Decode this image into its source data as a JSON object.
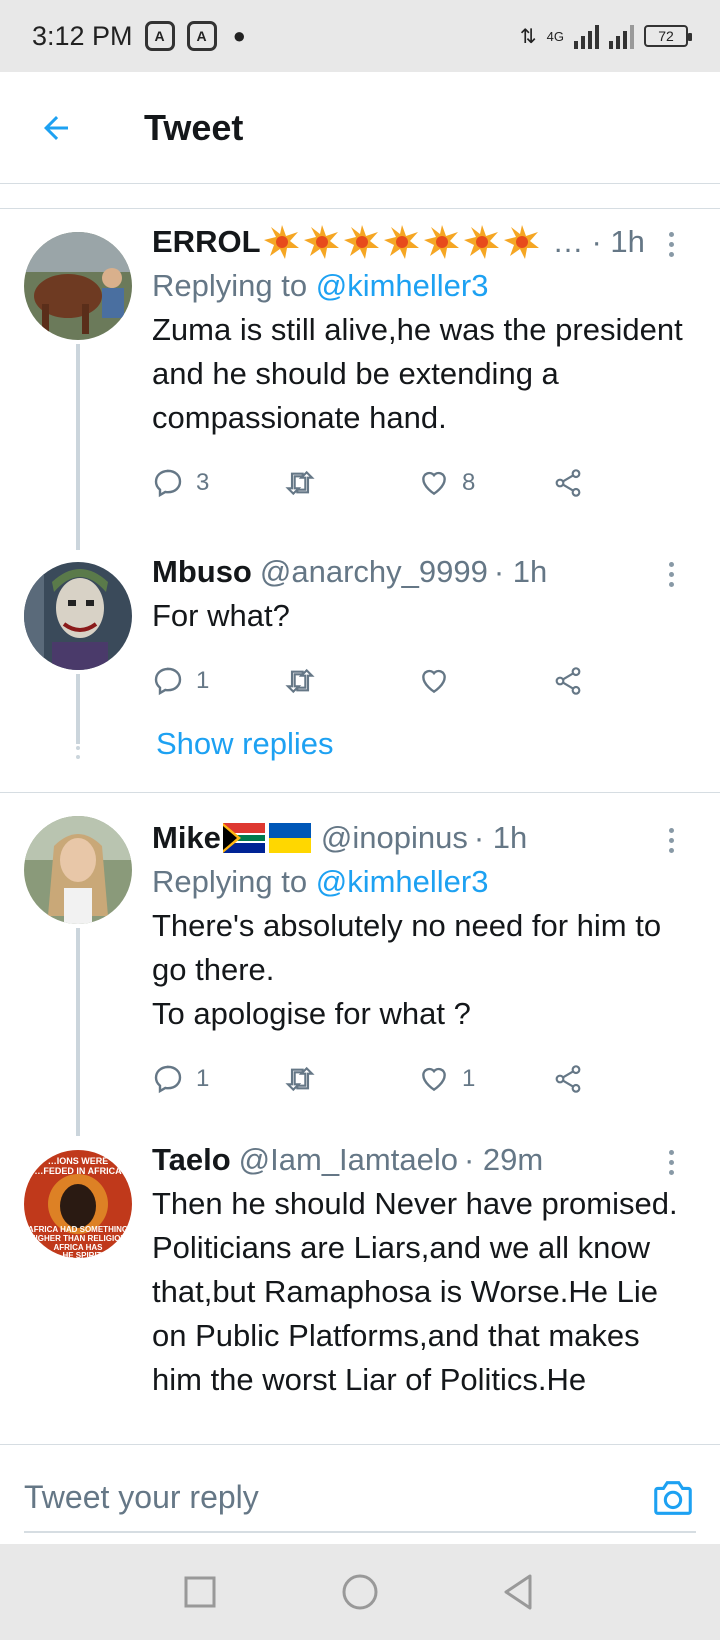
{
  "status": {
    "time": "3:12 PM",
    "network": "4G",
    "battery": "72"
  },
  "header": {
    "title": "Tweet"
  },
  "tweets": [
    {
      "name": "ERROL",
      "handle": "",
      "truncated": "…",
      "time": "· 1h",
      "replying_label": "Replying to",
      "replying_to": "@kimheller3",
      "text": "Zuma is still alive,he was the president and he should be extending a compassionate hand.",
      "replies": "3",
      "retweets": "",
      "likes": "8"
    },
    {
      "name": "Mbuso",
      "handle": "@anarchy_9999",
      "time": "· 1h",
      "text": "For what?",
      "replies": "1",
      "retweets": "",
      "likes": "",
      "show_replies": "Show replies"
    },
    {
      "name": "Mike",
      "handle": "@inopinus",
      "time": "· 1h",
      "replying_label": "Replying to",
      "replying_to": "@kimheller3",
      "text": "There's absolutely no need for him to go there.\nTo apologise for what ?",
      "replies": "1",
      "retweets": "",
      "likes": "1"
    },
    {
      "name": "Taelo",
      "handle": "@Iam_Iamtaelo",
      "time": "· 29m",
      "text": "Then he should Never have promised. Politicians are Liars,and we all know that,but Ramaphosa is Worse.He Lie on Public Platforms,and that makes him the worst Liar of Politics.He"
    }
  ],
  "avatar_text": {
    "taelo_top": "…IONS WERE\n…FEDED IN AFRICA",
    "taelo_bottom": "AFRICA HAD SOMETHING\nHIGHER THAN RELIGION\nAFRICA HAS\n…HE SPIRIT"
  },
  "reply": {
    "placeholder": "Tweet your reply"
  },
  "colors": {
    "accent": "#1da1f2",
    "secondary_text": "#657786"
  },
  "icons": [
    "back-arrow-icon",
    "more-vert-icon",
    "reply-icon",
    "retweet-icon",
    "like-icon",
    "share-icon",
    "camera-icon",
    "nav-recents-icon",
    "nav-home-icon",
    "nav-back-icon"
  ]
}
